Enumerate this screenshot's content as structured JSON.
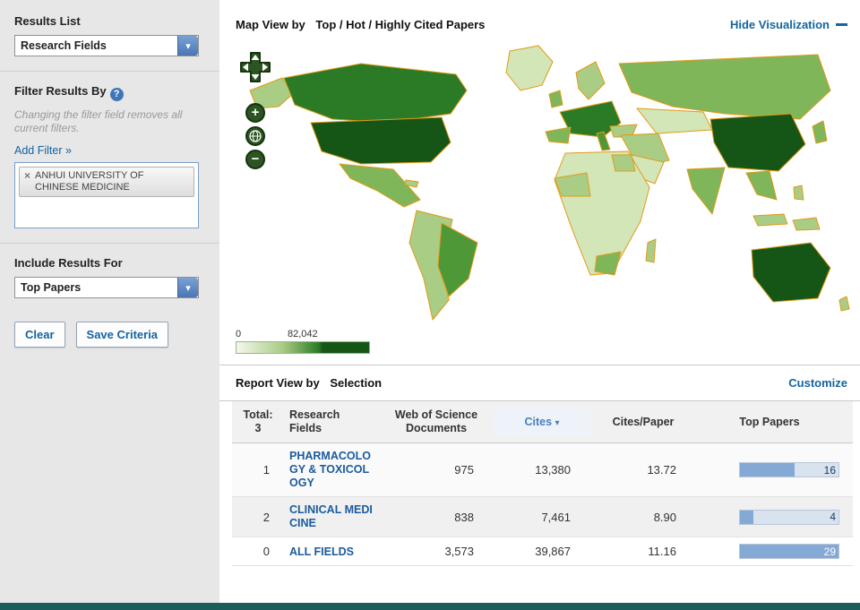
{
  "sidebar": {
    "results_list": {
      "label": "Results List",
      "value": "Research Fields"
    },
    "filter": {
      "label": "Filter Results By",
      "help_icon": "?",
      "note": "Changing the filter field removes all current filters.",
      "add_filter": "Add Filter »",
      "tag": {
        "remove_icon": "×",
        "label": "ANHUI UNIVERSITY OF CHINESE MEDICINE"
      },
      "input_value": ""
    },
    "include": {
      "label": "Include Results For",
      "value": "Top Papers"
    },
    "buttons": {
      "clear": "Clear",
      "save": "Save Criteria"
    }
  },
  "icons": {
    "chevron_down": "▾"
  },
  "map_section": {
    "title_prefix": "Map View by",
    "title": "Top / Hot / Highly Cited Papers",
    "hide_link": "Hide Visualization",
    "controls": {
      "zoom_in": "+",
      "zoom_out": "−"
    },
    "legend": {
      "min": "0",
      "max": "82,042"
    }
  },
  "report_section": {
    "title_prefix": "Report View by",
    "title": "Selection",
    "customize": "Customize"
  },
  "table": {
    "total_label": "Total:",
    "total_value": "3",
    "headers": {
      "field": "Research Fields",
      "docs": "Web of Science Documents",
      "cites": "Cites",
      "sort_icon": "▾",
      "cites_per_paper": "Cites/Paper",
      "top_papers": "Top Papers"
    },
    "rows": [
      {
        "rank": "1",
        "field": "PHARMACOLOGY & TOXICOLOGY",
        "docs": "975",
        "cites": "13,380",
        "cites_per_paper": "13.72",
        "top_papers": "16",
        "bar_pct": 55
      },
      {
        "rank": "2",
        "field": "CLINICAL MEDICINE",
        "docs": "838",
        "cites": "7,461",
        "cites_per_paper": "8.90",
        "top_papers": "4",
        "bar_pct": 14
      },
      {
        "rank": "0",
        "field": "ALL FIELDS",
        "docs": "3,573",
        "cites": "39,867",
        "cites_per_paper": "11.16",
        "top_papers": "29",
        "bar_pct": 100
      }
    ]
  }
}
